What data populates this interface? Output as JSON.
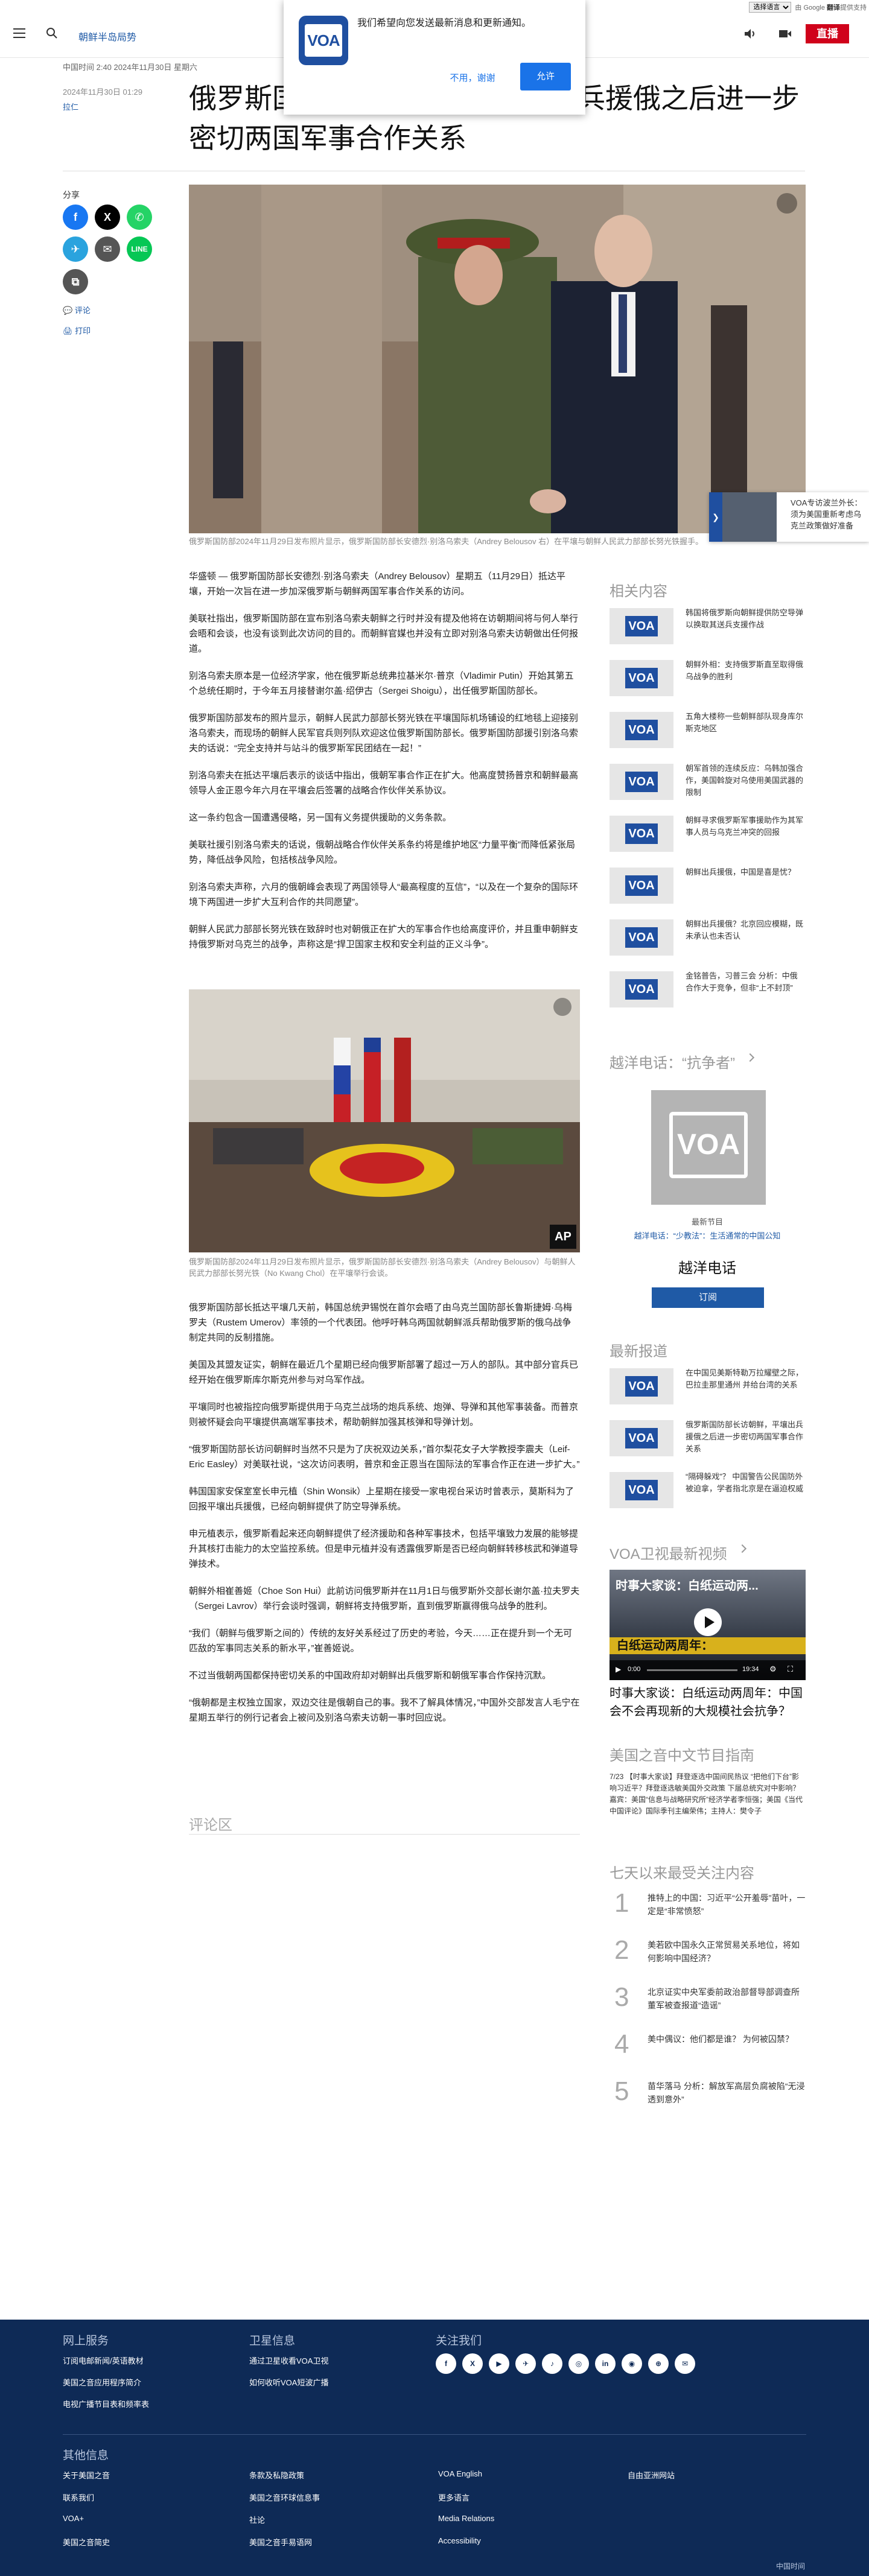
{
  "translate": {
    "select": "选择语言",
    "powered": "由 Google ",
    "brand": "翻译",
    "suffix": "提供支持"
  },
  "header": {
    "section": "朝鲜半岛局势",
    "live": "直播"
  },
  "notification": {
    "message": "我们希望向您发送最新消息和更新通知。",
    "decline": "不用，谢谢",
    "accept": "允许",
    "logo": "VOA"
  },
  "article": {
    "dateline": "中国时间 2:40 2024年11月30日 星期六",
    "pubdate": "2024年11月30日 01:29",
    "author": "拉仁",
    "title": "俄罗斯国防部长访朝鲜，平壤出兵援俄之后进一步密切两国军事合作关系",
    "share_label": "分享",
    "comments_link": "评论",
    "print_link": "打印",
    "hero_caption": "俄罗斯国防部2024年11月29日发布照片显示，俄罗斯国防部长安德烈·别洛乌索夫（Andrey Belousov 右）在平壤与朝鲜人民武力部部长努光铁握手。",
    "photo2_caption": "俄罗斯国防部2024年11月29日发布照片显示，俄罗斯国防部长安德烈·别洛乌索夫（Andrey Belousov）与朝鲜人民武力部部长努光铁（No Kwang Chol）在平壤举行会谈。",
    "photo2_badge": "AP",
    "paras_a": [
      "华盛顿 — 俄罗斯国防部长安德烈·别洛乌索夫（Andrey Belousov）星期五（11月29日）抵达平壤，开始一次旨在进一步加深俄罗斯与朝鲜两国军事合作关系的访问。",
      "美联社指出，俄罗斯国防部在宣布别洛乌索夫朝鲜之行时并没有提及他将在访朝期间将与何人举行会晤和会谈，也没有谈到此次访问的目的。而朝鲜官媒也并没有立即对别洛乌索夫访朝做出任何报道。",
      "别洛乌索夫原本是一位经济学家，他在俄罗斯总统弗拉基米尔·普京（Vladimir Putin）开始其第五个总统任期时，于今年五月接替谢尔盖·绍伊古（Sergei Shoigu），出任俄罗斯国防部长。",
      "俄罗斯国防部发布的照片显示，朝鲜人民武力部部长努光铁在平壤国际机场铺设的红地毯上迎接别洛乌索夫，而现场的朝鲜人民军官兵则列队欢迎这位俄罗斯国防部长。俄罗斯国防部援引别洛乌索夫的话说：“完全支持并与站斗的俄罗斯军民团结在一起！”",
      "别洛乌索夫在抵达平壤后表示的谈话中指出，俄朝军事合作正在扩大。他高度赞扬普京和朝鲜最高领导人金正恩今年六月在平壤会后签署的战略合作伙伴关系协议。",
      "这一条约包含一国遭遇侵略，另一国有义务提供援助的义务条款。",
      "美联社援引别洛乌索夫的话说，俄朝战略合作伙伴关系条约将是维护地区“力量平衡”而降低紧张局势，降低战争风险，包括核战争风险。",
      "别洛乌索夫声称，六月的俄朝峰会表现了两国领导人“最高程度的互信”，“以及在一个复杂的国际环境下两国进一步扩大互利合作的共同愿望”。",
      "朝鲜人民武力部部长努光铁在致辞时也对朝俄正在扩大的军事合作也给高度评价，并且重申朝鲜支持俄罗斯对乌克兰的战争，声称这是“捍卫国家主权和安全利益的正义斗争”。"
    ],
    "paras_b": [
      "俄罗斯国防部长抵达平壤几天前，韩国总统尹锡悦在首尔会晤了由乌克兰国防部长鲁斯捷姆·乌梅罗夫（Rustem Umerov）率领的一个代表团。他呼吁韩乌两国就朝鲜派兵帮助俄罗斯的俄乌战争制定共同的反制措施。",
      "美国及其盟友证实，朝鲜在最近几个星期已经向俄罗斯部署了超过一万人的部队。其中部分官兵已经开始在俄罗斯库尔斯克州参与对乌军作战。",
      "平壤同时也被指控向俄罗斯提供用于乌克兰战场的炮兵系统、炮弹、导弹和其他军事装备。而普京则被怀疑会向平壤提供高端军事技术，帮助朝鲜加强其核弹和导弹计划。",
      "“俄罗斯国防部长访问朝鲜时当然不只是为了庆祝双边关系，”首尔梨花女子大学教授李震夫（Leif-Eric Easley）对美联社说，“这次访问表明，普京和金正恩当在国际法的军事合作正在进一步扩大。”",
      "韩国国家安保室室长申元植（Shin Wonsik）上星期在接受一家电视台采访时曾表示，莫斯科为了回报平壤出兵援俄，已经向朝鲜提供了防空导弹系统。",
      "申元植表示，俄罗斯看起来还向朝鲜提供了经济援助和各种军事技术，包括平壤致力发展的能够提升其核打击能力的太空监控系统。但是申元植并没有透露俄罗斯是否已经向朝鲜转移核武和弹道导弹技术。",
      "朝鲜外相崔善姬（Choe Son Hui）此前访问俄罗斯并在11月1日与俄罗斯外交部长谢尔盖·拉夫罗夫（Sergei Lavrov）举行会谈时强调，朝鲜将支持俄罗斯，直到俄罗斯赢得俄乌战争的胜利。",
      "“我们（朝鲜与俄罗斯之间的）传统的友好关系经过了历史的考验，今天……正在提升到一个无可匹敌的军事同志关系的新水平，”崔善姬说。",
      "不过当俄朝两国都保持密切关系的中国政府却对朝鲜出兵俄罗斯和朝俄军事合作保持沉默。",
      "“俄朝都是主权独立国家，双边交往是俄朝自己的事。我不了解具体情况，”中国外交部发言人毛宁在星期五举行的例行记者会上被问及别洛乌索夫访朝一事时回应说。"
    ],
    "comments_area": "评论区"
  },
  "promo": {
    "text": "VOA专访波兰外长：须为美国重新考虑乌克兰政策做好准备"
  },
  "sidebar": {
    "related_heading": "相关内容",
    "thumb_label": "VOA",
    "related": [
      "韩国将俄罗斯向朝鲜提供防空导弹 以换取其送兵支援作战",
      "朝鲜外相：支持俄罗斯直至取得俄乌战争的胜利",
      "五角大楼称一些朝鲜部队现身库尔斯克地区",
      "朝军首领的连续反应：乌韩加强合作，美国斡旋对乌使用美国武器的限制",
      "朝鲜寻求俄罗斯军事援助作为其军事人员与乌克兰冲突的回报",
      "朝鲜出兵援俄，中国是喜是忧？",
      "朝鲜出兵援俄？北京回应模糊，既未承认也未否认",
      "金铭普告，习普三会 分析：中俄合作大于竞争，但非“上不封顶”"
    ],
    "podcast_heading": "越洋电话：“抗争者”",
    "podcast_latest": "最新节目",
    "podcast_episode": "越洋电话：“少教法”：生活通常的中国公知",
    "podcast_name": "越洋电话",
    "podcast_subscribe": "订阅",
    "podcast_logo": "VOA",
    "latest_heading": "最新报道",
    "latest": [
      "在中国见美斯特勒万拉耀壁之际，巴拉圭那里通州 并给台湾的关系",
      "俄罗斯国防部长访朝鲜，平壤出兵援俄之后进一步密切两国军事合作关系",
      "“隔碍躲戏”？ 中国警告公民国防外被迫拿，学者指北京是在逼迫权威"
    ],
    "video_heading": "VOA卫视最新视频",
    "video_overlay": "时事大家谈：白纸运动两...",
    "video_banner": "白纸运动两周年：",
    "video_time_current": "0:00",
    "video_time_total": "19:34",
    "video_title": "时事大家谈：白纸运动两周年：中国会不会再现新的大规模社会抗争？",
    "us_heading": "美国之音中文节目指南",
    "us_text": "7/23 【时事大家谈】拜登逐选中国间民热议 “把他们下台”影响习近平？拜登逐选敏美国外交政策 下届总统究对中影响？ 嘉宾：美国“信息与战略研究所”经济学者李恒强；美国《当代中国评论》国际季刊主编荣伟；主持人：樊令子",
    "top_heading": "七天以来最受关注内容",
    "top": [
      "推特上的中国：习近平“公开羞辱”苗叶，一定是“非常愤怒”",
      "美若欧中国永久正常贸易关系地位，将如何影响中国经济？",
      "北京证实中央军委前政治部督导部调查所董军被查报道“造谣”",
      "美中偶议：他们都是谁？ 为何被囚禁？",
      "苗华落马 分析：解放军高层负腐被陷“无浸透到意外”"
    ]
  },
  "footer": {
    "col1_heading": "网上服务",
    "col1_links": [
      "订阅电邮新闻/英语教材",
      "美国之音应用程序简介",
      "电视广播节目表和频率表"
    ],
    "col2_heading": "卫星信息",
    "col2_links": [
      "通过卫星收看VOA卫视",
      "如何收听VOA短波广播"
    ],
    "col3_heading": "关注我们",
    "social": [
      "f",
      "X",
      "▶",
      "✈",
      "♪",
      "◎",
      "in",
      "◉",
      "⊕",
      "✉"
    ],
    "other_heading": "其他信息",
    "other_links": [
      "关于美国之音",
      "联系我们",
      "VOA+",
      "美国之音简史"
    ],
    "other_links2": [
      "条款及私隐政策",
      "美国之音环球信息事",
      "社论",
      "美国之音手易语网"
    ],
    "other_links3": [
      "VOA English",
      "更多语言",
      "Media Relations",
      "Accessibility"
    ],
    "other_links4": [
      "自由亚洲网站"
    ],
    "clock": "中国时间"
  }
}
